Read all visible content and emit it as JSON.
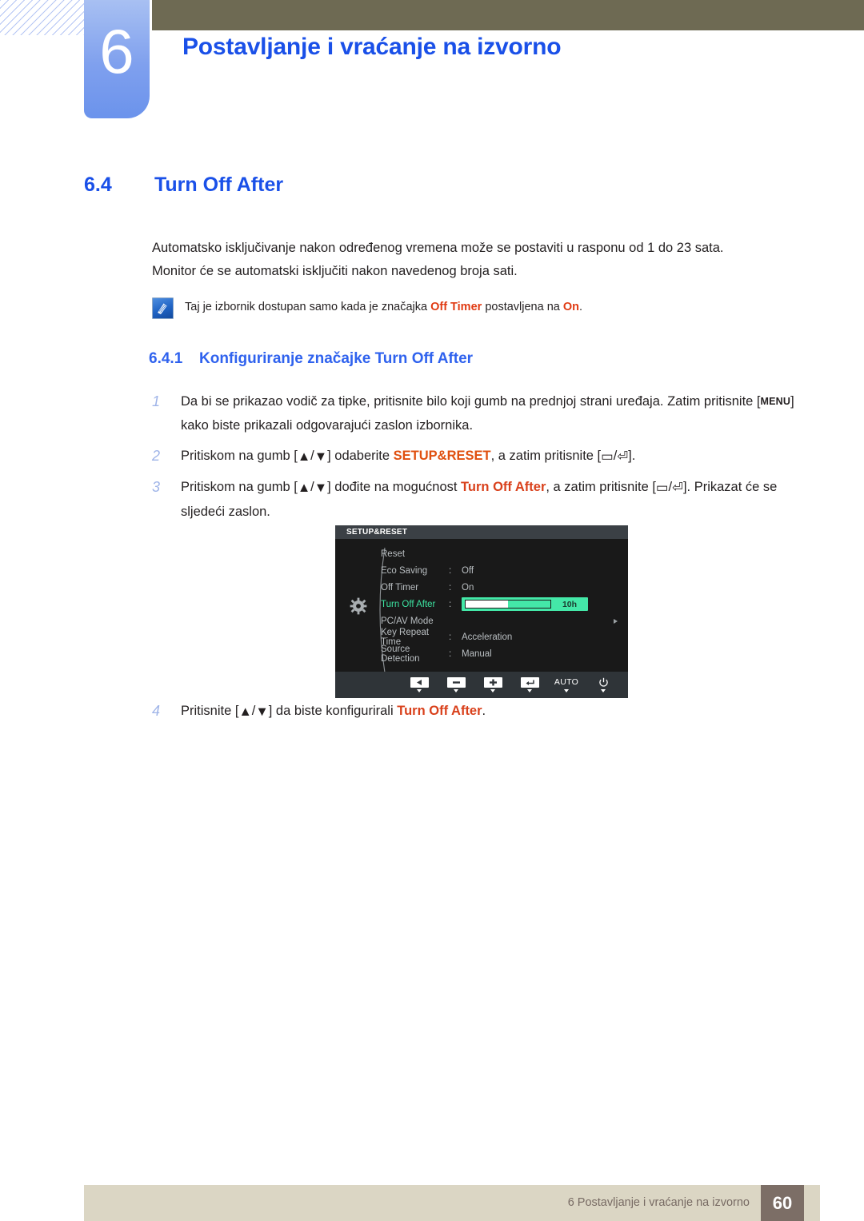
{
  "header": {
    "chapter_number": "6",
    "chapter_title": "Postavljanje i vraćanje na izvorno",
    "accent_blue": "#1a50e8",
    "olive": "#6e6a53"
  },
  "section": {
    "number": "6.4",
    "title": "Turn Off After"
  },
  "intro": {
    "line1": "Automatsko isključivanje nakon određenog vremena može se postaviti u rasponu od 1 do 23 sata.",
    "line2": "Monitor će se automatski isključiti nakon navedenog broja sati."
  },
  "note": {
    "icon": "note-pencil-icon",
    "text_before": "Taj je izbornik dostupan samo kada je značajka ",
    "highlight_1": "Off Timer",
    "text_middle": " postavljena na ",
    "highlight_2": "On",
    "text_after": "."
  },
  "subsection": {
    "number": "6.4.1",
    "title": "Konfiguriranje značajke Turn Off After"
  },
  "steps": [
    {
      "number": "1",
      "part1": "Da bi se prikazao vodič za tipke, pritisnite bilo koji gumb na prednjoj strani uređaja. Zatim pritisnite [",
      "keycap": "MENU",
      "part2": "] kako biste prikazali odgovarajući zaslon izbornika."
    },
    {
      "number": "2",
      "part1": "Pritiskom na gumb [",
      "up": "▲",
      "sep": "/",
      "down": "▼",
      "part2": "] odaberite ",
      "highlight": "SETUP&RESET",
      "part3": ", a zatim pritisnite [",
      "icon1": "▭",
      "icon2": "⏎",
      "part4": "]."
    },
    {
      "number": "3",
      "part1": "Pritiskom na gumb [",
      "up": "▲",
      "sep": "/",
      "down": "▼",
      "part2": "] dođite na mogućnost ",
      "highlight": "Turn Off After",
      "part3": ", a zatim pritisnite [",
      "icon1": "▭",
      "icon2": "⏎",
      "part4": "]. Prikazat će se sljedeći zaslon."
    },
    {
      "number": "4",
      "part1": "Pritisnite [",
      "up": "▲",
      "sep": "/",
      "down": "▼",
      "part2": "] da biste konfigurirali ",
      "highlight": "Turn Off After",
      "part3": "."
    }
  ],
  "osd": {
    "title": "SETUP&RESET",
    "gear_icon": "gear-icon",
    "highlight_color": "#3ce2a0",
    "rows": [
      {
        "label": "Reset",
        "colon": "",
        "value": "",
        "active": false
      },
      {
        "label": "Eco Saving",
        "colon": ":",
        "value": "Off",
        "active": false
      },
      {
        "label": "Off Timer",
        "colon": ":",
        "value": "On",
        "active": false
      },
      {
        "label": "Turn Off After",
        "colon": ":",
        "value": "10h",
        "active": true
      },
      {
        "label": "PC/AV Mode",
        "colon": "",
        "value": "",
        "active": false
      },
      {
        "label": "Key Repeat Time",
        "colon": ":",
        "value": "Acceleration",
        "active": false
      },
      {
        "label": "Source Detection",
        "colon": ":",
        "value": "Manual",
        "active": false
      }
    ],
    "slider": {
      "value_label": "10h",
      "fill_percent": 50
    },
    "buttons": [
      {
        "name": "back-button",
        "glyph": "◀",
        "type": "icon"
      },
      {
        "name": "minus-button",
        "glyph": "▬",
        "type": "icon"
      },
      {
        "name": "plus-button",
        "glyph": "✚",
        "type": "icon"
      },
      {
        "name": "enter-button",
        "glyph": "⏎",
        "type": "icon"
      },
      {
        "name": "auto-button",
        "glyph": "AUTO",
        "type": "text"
      },
      {
        "name": "power-button",
        "glyph": "⏻",
        "type": "text"
      }
    ]
  },
  "footer": {
    "text": "6 Postavljanje i vraćanje na izvorno",
    "page": "60"
  }
}
